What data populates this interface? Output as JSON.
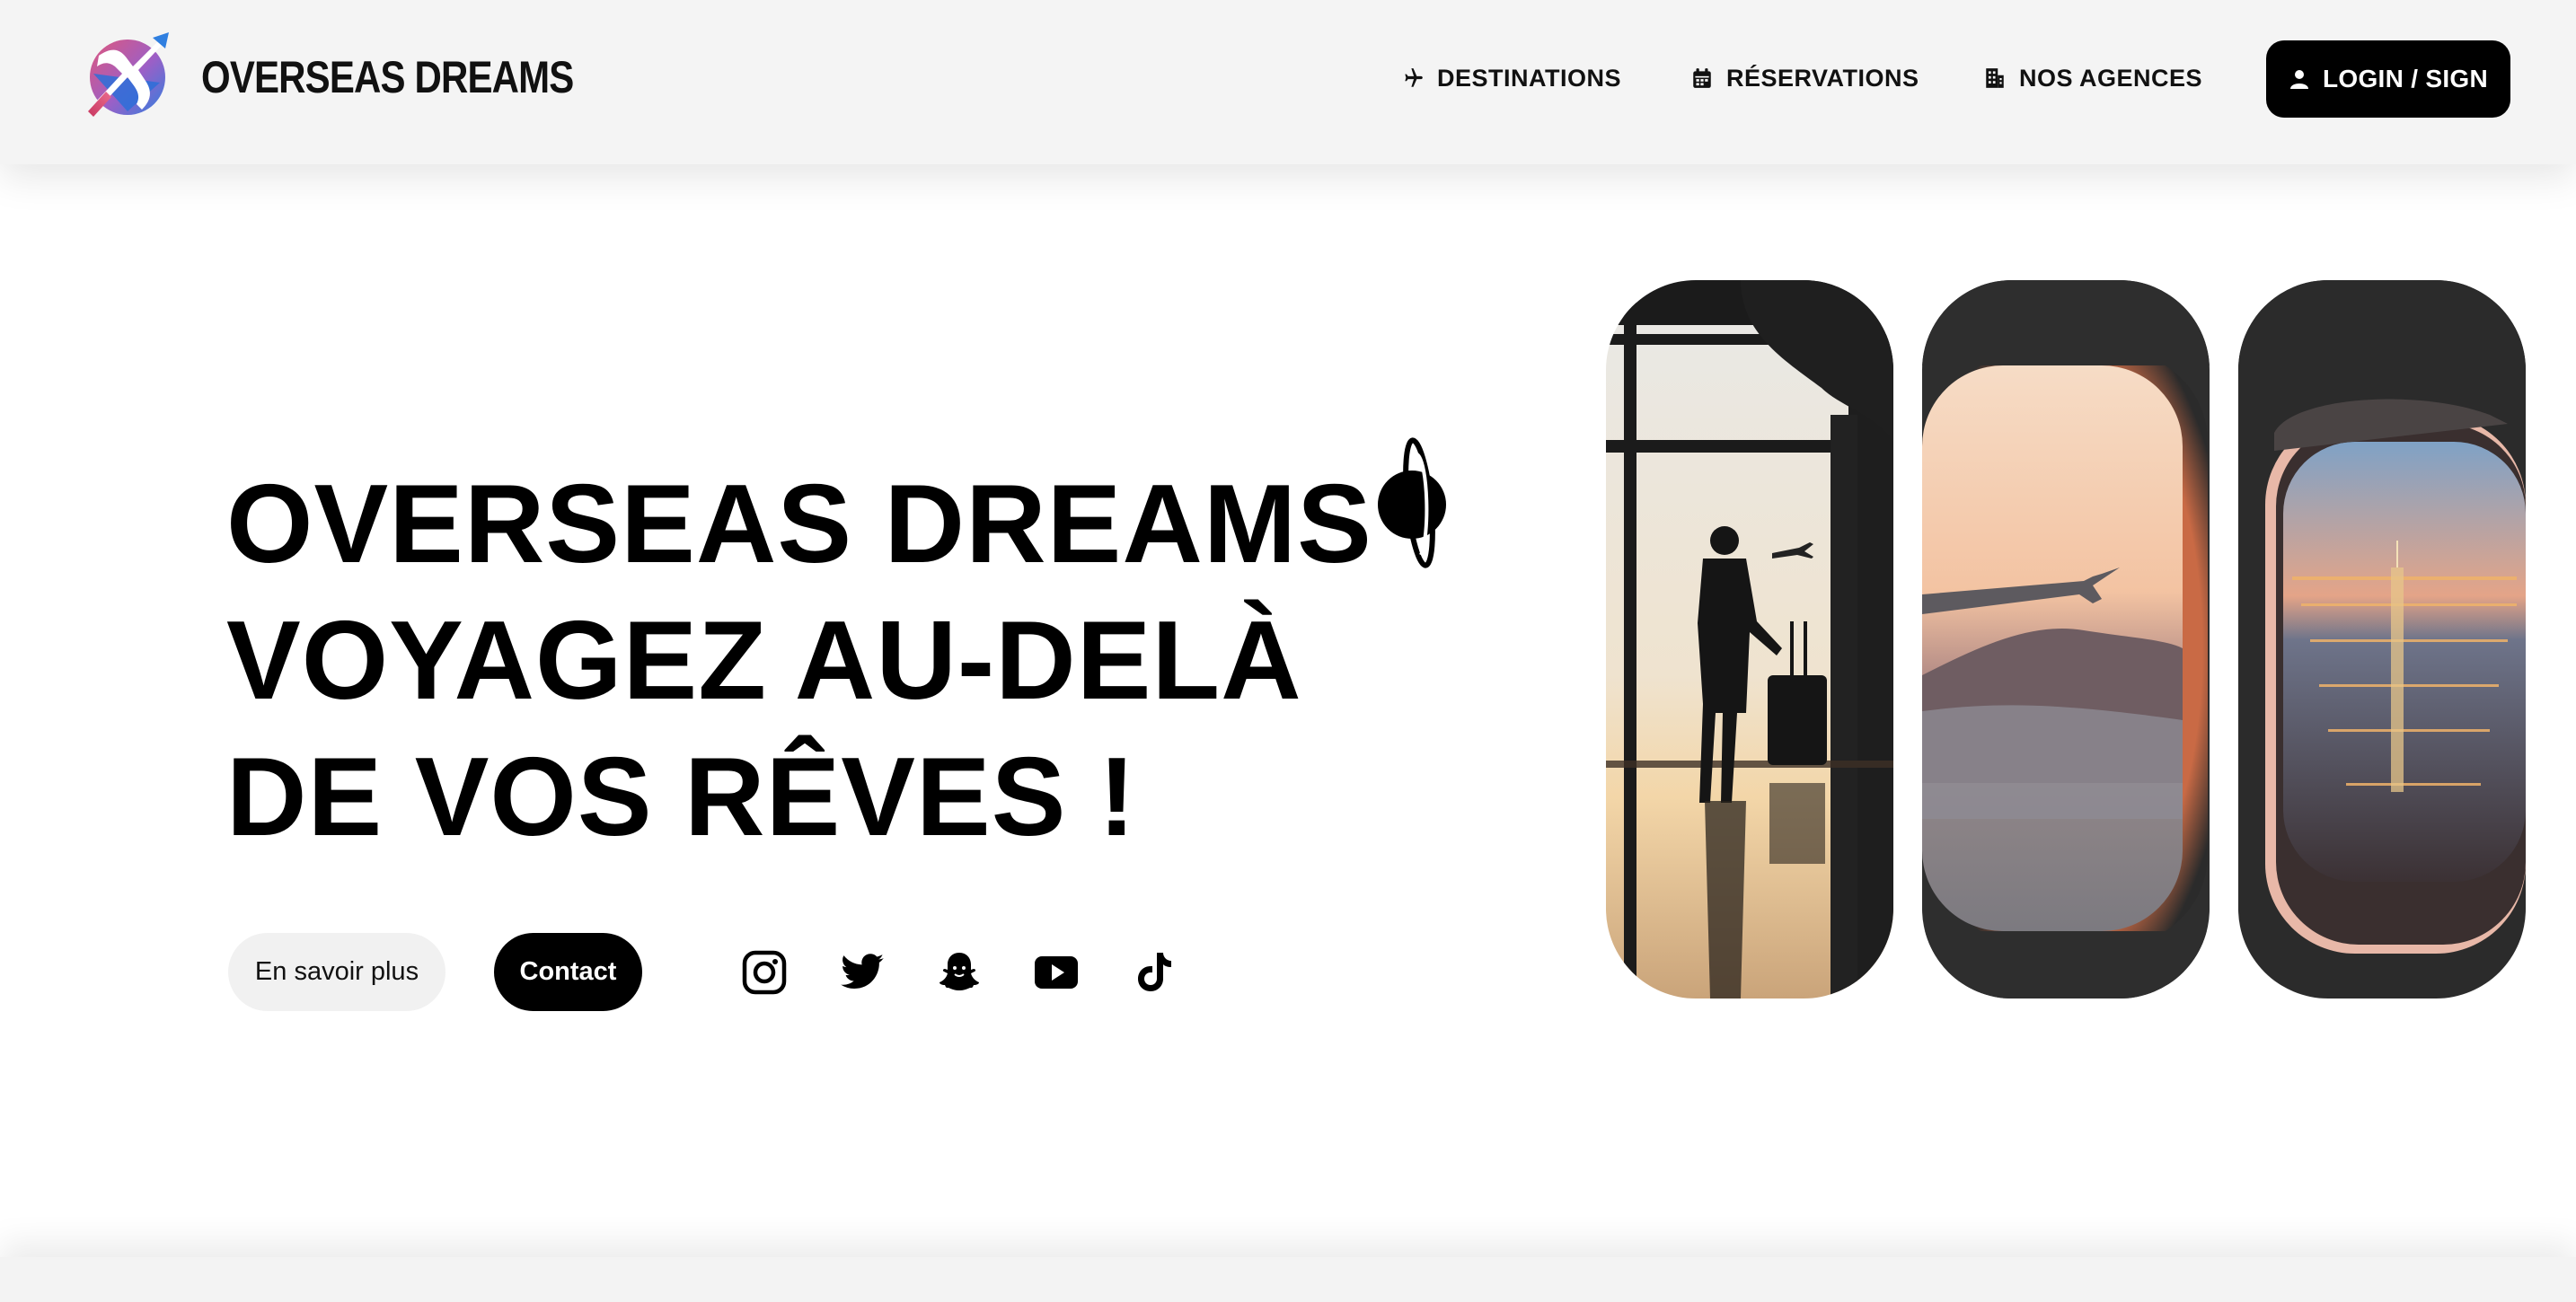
{
  "header": {
    "brand": "OVERSEAS DREAMS",
    "logo_icon": "airplane-globe-logo",
    "nav": [
      {
        "label": "DESTINATIONS",
        "icon": "plane-icon"
      },
      {
        "label": "RÉSERVATIONS",
        "icon": "calendar-icon"
      },
      {
        "label": "NOS AGENCES",
        "icon": "building-icon"
      }
    ],
    "login": {
      "label": "LOGIN / SIGN",
      "icon": "user-icon"
    }
  },
  "hero": {
    "title_lines": [
      "OVERSEAS DREAMS",
      "VOYAGEZ AU-DELÀ",
      "DE VOS RÊVES !"
    ],
    "title_icon": "planet-icon",
    "buttons": {
      "more": "En savoir plus",
      "contact": "Contact"
    },
    "socials": [
      "instagram-icon",
      "twitter-icon",
      "snapchat-icon",
      "youtube-icon",
      "tiktok-icon"
    ]
  },
  "gallery": [
    {
      "subject": "traveler-silhouette-airport"
    },
    {
      "subject": "airplane-wing-window-sunset"
    },
    {
      "subject": "airplane-window-city-night"
    }
  ],
  "colors": {
    "header_bg": "#f4f4f4",
    "primary": "#000000",
    "secondary_button_bg": "#f1f1f1",
    "logo_pink": "#d9467a",
    "logo_blue": "#2f7fe0"
  }
}
